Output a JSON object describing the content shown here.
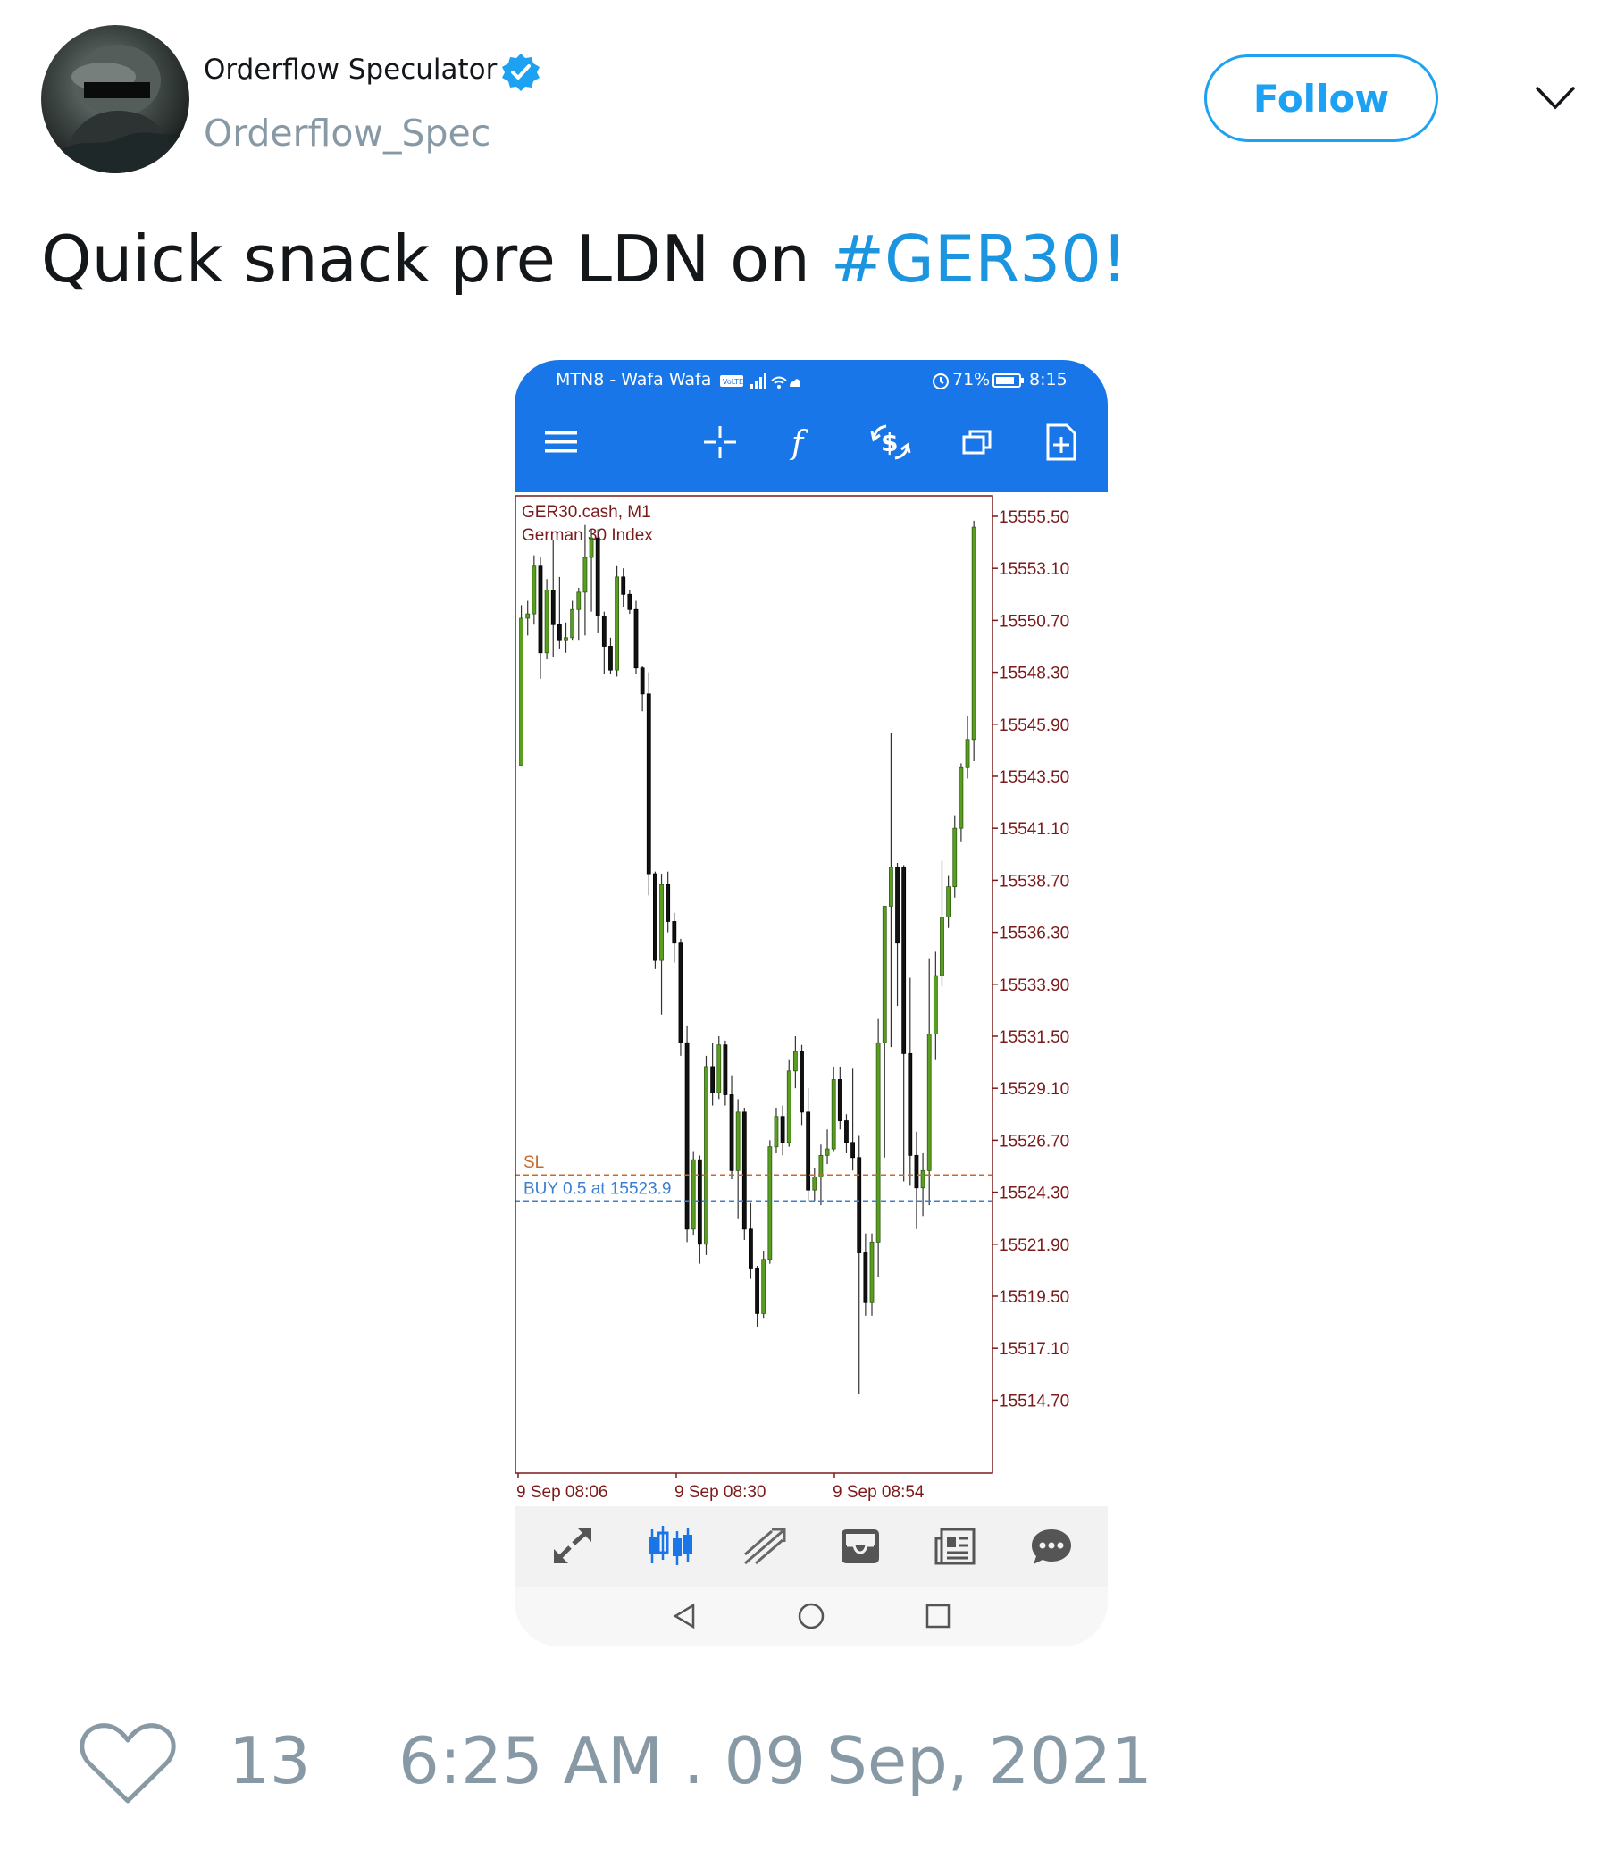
{
  "tweet": {
    "display_name": "Orderflow Speculator",
    "username": "Orderflow_Spec",
    "verified_icon": "verified-badge-icon",
    "follow_label": "Follow",
    "text_plain": "Quick snack pre LDN on ",
    "hashtag": "#GER30!",
    "like_count": "13",
    "timestamp": "6:25 AM . 09 Sep, 2021",
    "colors": {
      "accent": "#1da1f2",
      "hashtag": "#1b95e0",
      "muted": "#8899a6",
      "text": "#14171a"
    }
  },
  "phone": {
    "status_bar": {
      "carrier": "MTN8 - Wafa Wafa",
      "battery": "71%",
      "time": "8:15"
    },
    "toolbar_icons": [
      "menu-icon",
      "crosshair-icon",
      "indicators-icon",
      "trade-icon",
      "windows-icon",
      "new-order-icon"
    ],
    "bottom_nav_icons": [
      "quotes-icon",
      "chart-icon",
      "trade-icon",
      "history-icon",
      "news-icon",
      "chat-icon"
    ],
    "android_nav_icons": [
      "back-icon",
      "home-icon",
      "recents-icon"
    ],
    "colors": {
      "appbar": "#1976e8",
      "bull": "#5a9e21",
      "bear": "#111111",
      "axis": "#7b1a1a"
    }
  },
  "chart_data": {
    "type": "candlestick",
    "symbol": "GER30.cash, M1",
    "description": "German 30 Index",
    "y_ticks": [
      "15555.50",
      "15553.10",
      "15550.70",
      "15548.30",
      "15545.90",
      "15543.50",
      "15541.10",
      "15538.70",
      "15536.30",
      "15533.90",
      "15531.50",
      "15529.10",
      "15526.70",
      "15524.30",
      "15521.90",
      "15519.50",
      "15517.10",
      "15514.70"
    ],
    "y_range": [
      15511.5,
      15556.2
    ],
    "x_ticks": [
      "9 Sep 08:06",
      "9 Sep 08:30",
      "9 Sep 08:54"
    ],
    "lines": [
      {
        "label": "SL",
        "value": 15525.1,
        "color": "#c86a2a"
      },
      {
        "label": "BUY 0.5 at 15523.9",
        "value": 15523.9,
        "color": "#3b7fd0"
      }
    ],
    "candles": [
      [
        15544,
        15551.4,
        15544,
        15550.8
      ],
      [
        15550.8,
        15551.6,
        15550,
        15551.0
      ],
      [
        15551.0,
        15553.7,
        15550.5,
        15553.2
      ],
      [
        15553.2,
        15553.6,
        15548,
        15549.2
      ],
      [
        15549.2,
        15552.6,
        15548.9,
        15552.1
      ],
      [
        15552.1,
        15554.4,
        15549,
        15550.5
      ],
      [
        15550.5,
        15552.7,
        15549.4,
        15549.8
      ],
      [
        15549.8,
        15550.6,
        15549.2,
        15549.9
      ],
      [
        15549.9,
        15551.6,
        15549.8,
        15551.2
      ],
      [
        15551.2,
        15552.2,
        15549.8,
        15552.0
      ],
      [
        15552.0,
        15555.1,
        15550,
        15553.6
      ],
      [
        15553.6,
        15554.9,
        15551.1,
        15554.5
      ],
      [
        15554.5,
        15554.9,
        15550.1,
        15550.9
      ],
      [
        15550.9,
        15551.1,
        15548.2,
        15549.5
      ],
      [
        15549.5,
        15549.9,
        15548.2,
        15548.4
      ],
      [
        15548.4,
        15553.2,
        15548.1,
        15552.7
      ],
      [
        15552.7,
        15553.1,
        15551.3,
        15551.9
      ],
      [
        15551.9,
        15552.1,
        15551,
        15551.2
      ],
      [
        15551.2,
        15551.6,
        15548.2,
        15548.5
      ],
      [
        15548.5,
        15548.6,
        15546.5,
        15547.3
      ],
      [
        15547.3,
        15548.3,
        15538,
        15539.0
      ],
      [
        15539.0,
        15539.1,
        15534.6,
        15535.0
      ],
      [
        15535.0,
        15539.0,
        15532.5,
        15538.5
      ],
      [
        15538.5,
        15539.1,
        15536.3,
        15536.8
      ],
      [
        15536.8,
        15537.2,
        15534.9,
        15535.8
      ],
      [
        15535.8,
        15536,
        15530.6,
        15531.2
      ],
      [
        15531.2,
        15532.0,
        15522.0,
        15522.6
      ],
      [
        15522.6,
        15526.2,
        15522.3,
        15525.8
      ],
      [
        15525.8,
        15526,
        15521.0,
        15521.9
      ],
      [
        15521.9,
        15530.6,
        15521.4,
        15530.1
      ],
      [
        15530.1,
        15531.2,
        15528.3,
        15528.9
      ],
      [
        15528.9,
        15531.5,
        15528.6,
        15531.1
      ],
      [
        15531.1,
        15531.3,
        15528.3,
        15528.8
      ],
      [
        15528.8,
        15529.7,
        15524.9,
        15525.3
      ],
      [
        15525.3,
        15528.6,
        15523.1,
        15528.0
      ],
      [
        15528.0,
        15528.2,
        15522.1,
        15522.6
      ],
      [
        15522.6,
        15523.8,
        15520.3,
        15520.8
      ],
      [
        15520.8,
        15520.9,
        15518.1,
        15518.7
      ],
      [
        15518.7,
        15521.6,
        15518.5,
        15521.2
      ],
      [
        15521.2,
        15526.7,
        15521.0,
        15526.4
      ],
      [
        15526.4,
        15528.2,
        15526.1,
        15527.8
      ],
      [
        15527.8,
        15528.3,
        15526.0,
        15526.6
      ],
      [
        15526.6,
        15530.4,
        15526.4,
        15529.9
      ],
      [
        15529.9,
        15531.5,
        15529.1,
        15530.8
      ],
      [
        15530.8,
        15531.1,
        15527.4,
        15528.0
      ],
      [
        15528.0,
        15529.1,
        15523.9,
        15524.4
      ],
      [
        15524.4,
        15525.4,
        15523.9,
        15525.0
      ],
      [
        15525.0,
        15526.5,
        15523.7,
        15526.0
      ],
      [
        15526.0,
        15527.2,
        15525.6,
        15526.3
      ],
      [
        15526.3,
        15530.1,
        15526.2,
        15529.5
      ],
      [
        15529.5,
        15530.1,
        15527.2,
        15527.6
      ],
      [
        15527.6,
        15527.9,
        15526.1,
        15526.6
      ],
      [
        15526.6,
        15530.0,
        15525.3,
        15525.9
      ],
      [
        15525.9,
        15526.9,
        15515.0,
        15521.5
      ],
      [
        15521.5,
        15522.4,
        15518.6,
        15519.2
      ],
      [
        15519.2,
        15522.4,
        15518.6,
        15522.0
      ],
      [
        15522.0,
        15532.3,
        15520.4,
        15531.2
      ],
      [
        15531.2,
        15534.4,
        15525.9,
        15537.5
      ],
      [
        15537.5,
        15545.5,
        15531.0,
        15539.3
      ],
      [
        15539.3,
        15539.5,
        15532.9,
        15535.8
      ],
      [
        15539.3,
        15539.4,
        15524.8,
        15530.7
      ],
      [
        15530.7,
        15534.2,
        15524.6,
        15526.0
      ],
      [
        15526.0,
        15527.1,
        15522.6,
        15524.5
      ],
      [
        15524.5,
        15526.1,
        15523.2,
        15525.3
      ],
      [
        15525.3,
        15535.1,
        15523.7,
        15531.6
      ],
      [
        15531.6,
        15535.4,
        15530.4,
        15534.3
      ],
      [
        15534.3,
        15539.6,
        15533.8,
        15537.0
      ],
      [
        15537.0,
        15538.9,
        15536.5,
        15538.4
      ],
      [
        15538.4,
        15541.7,
        15537.9,
        15541.1
      ],
      [
        15541.1,
        15544.1,
        15540.5,
        15543.9
      ],
      [
        15543.9,
        15546.3,
        15543.4,
        15545.2
      ],
      [
        15545.2,
        15555.3,
        15544.2,
        15555.0
      ]
    ]
  }
}
